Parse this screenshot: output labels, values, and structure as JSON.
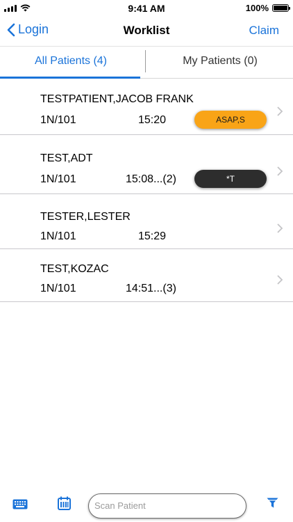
{
  "status_bar": {
    "time": "9:41 AM",
    "battery": "100%",
    "battery_level": 1.0
  },
  "nav": {
    "back_label": "Login",
    "title": "Worklist",
    "action_label": "Claim"
  },
  "tabs": [
    {
      "label": "All Patients (4)",
      "selected": true
    },
    {
      "label": "My Patients (0)",
      "selected": false
    }
  ],
  "patients": [
    {
      "name": "TESTPATIENT,JACOB FRANK",
      "location": "1N/101",
      "time": "15:20",
      "badge": "ASAP,S",
      "badge_color": "#f9a417"
    },
    {
      "name": "TEST,ADT",
      "location": "1N/101",
      "time": "15:08...(2)",
      "badge": "*T",
      "badge_color": "#2d2d2d"
    },
    {
      "name": "TESTER,LESTER",
      "location": "1N/101",
      "time": "15:29",
      "badge": ""
    },
    {
      "name": "TEST,KOZAC",
      "location": "1N/101",
      "time": "14:51...(3)",
      "badge": ""
    }
  ],
  "toolbar": {
    "scan_placeholder": "Scan Patient",
    "icons": [
      "keyboard-icon",
      "calendar-icon",
      "filter-icon"
    ],
    "accent_color": "#1a73d9"
  }
}
